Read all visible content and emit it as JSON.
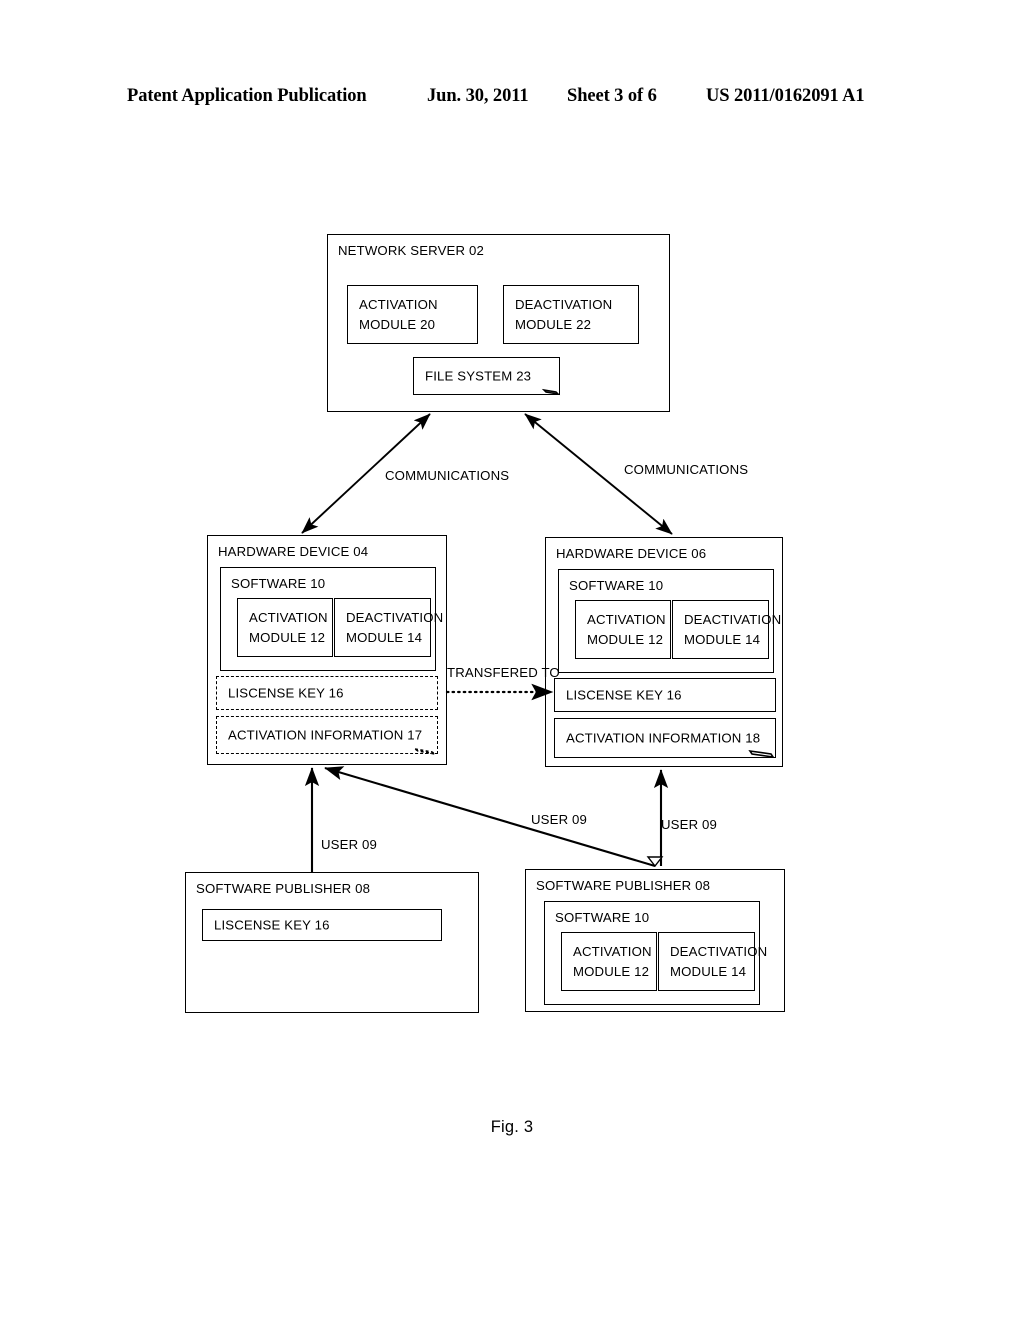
{
  "header": {
    "publication": "Patent Application Publication",
    "date": "Jun. 30, 2011",
    "sheet": "Sheet 3 of 6",
    "patent_number": "US 2011/0162091 A1"
  },
  "figure": {
    "caption": "Fig. 3"
  },
  "network_server": {
    "title": "NETWORK SERVER 02",
    "activation_module": {
      "line1": "ACTIVATION",
      "line2": "MODULE 20"
    },
    "deactivation_module": {
      "line1": "DEACTIVATION",
      "line2": "MODULE 22"
    },
    "file_system": "FILE SYSTEM 23"
  },
  "hardware_device_04": {
    "title": "HARDWARE DEVICE 04",
    "software": {
      "title": "SOFTWARE 10",
      "activation_module": {
        "line1": "ACTIVATION",
        "line2": "MODULE 12"
      },
      "deactivation_module": {
        "line1": "DEACTIVATION",
        "line2": "MODULE 14"
      }
    },
    "license_key": "LISCENSE KEY 16",
    "activation_information": "ACTIVATION INFORMATION 17"
  },
  "hardware_device_06": {
    "title": "HARDWARE DEVICE 06",
    "software": {
      "title": "SOFTWARE 10",
      "activation_module": {
        "line1": "ACTIVATION",
        "line2": "MODULE 12"
      },
      "deactivation_module": {
        "line1": "DEACTIVATION",
        "line2": "MODULE 14"
      }
    },
    "license_key": "LISCENSE KEY 16",
    "activation_information": "ACTIVATION INFORMATION 18"
  },
  "software_publisher_left": {
    "title": "SOFTWARE PUBLISHER 08",
    "license_key": "LISCENSE KEY 16"
  },
  "software_publisher_right": {
    "title": "SOFTWARE PUBLISHER 08",
    "software": {
      "title": "SOFTWARE 10",
      "activation_module": {
        "line1": "ACTIVATION",
        "line2": "MODULE 12"
      },
      "deactivation_module": {
        "line1": "DEACTIVATION",
        "line2": "MODULE 14"
      }
    }
  },
  "edge_labels": {
    "communications_left": "COMMUNICATIONS",
    "communications_right": "COMMUNICATIONS",
    "transferred_to": "TRANSFERED TO",
    "user_left": "USER 09",
    "user_middle": "USER 09",
    "user_right": "USER 09"
  },
  "colors": {
    "stroke": "#000000",
    "background": "#ffffff"
  }
}
